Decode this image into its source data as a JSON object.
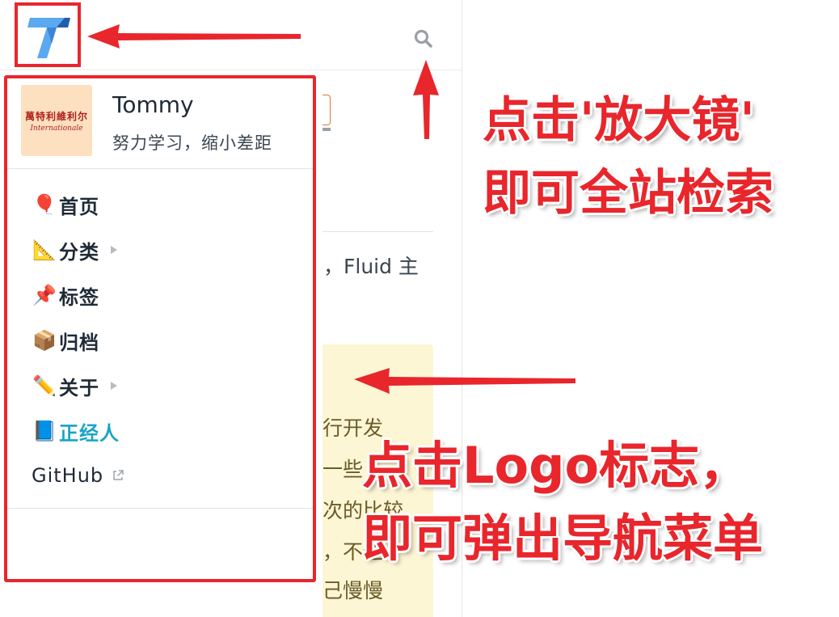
{
  "header": {
    "logo_icon": "fluid-t-logo-icon",
    "search_icon": "search-icon"
  },
  "profile": {
    "avatar_text_cn": "萬特利維利尔",
    "avatar_text_en": "Internationale",
    "name": "Tommy",
    "motto": "努力学习，缩小差距"
  },
  "nav": {
    "items": [
      {
        "emoji": "🎈",
        "icon": "balloon-icon",
        "label": "首页",
        "has_submenu": false
      },
      {
        "emoji": "📐",
        "icon": "triangle-ruler-icon",
        "label": "分类",
        "has_submenu": true
      },
      {
        "emoji": "📌",
        "icon": "pushpin-icon",
        "label": "标签",
        "has_submenu": false
      },
      {
        "emoji": "📦",
        "icon": "package-icon",
        "label": "归档",
        "has_submenu": false
      },
      {
        "emoji": "✏️",
        "icon": "pencil-icon",
        "label": "关于",
        "has_submenu": true
      },
      {
        "emoji": "📘",
        "icon": "blue-book-icon",
        "label": "正经人",
        "has_submenu": false,
        "active": true
      }
    ],
    "github_label": "GitHub",
    "external_icon": "external-link-icon"
  },
  "background_page": {
    "fluid_text": "，Fluid 主",
    "note_lines": [
      "行开发",
      "一些",
      "次的比较",
      "，不过",
      "己慢慢"
    ]
  },
  "annotations": {
    "search_hint_line1": "点击'放大镜'",
    "search_hint_line2": "即可全站检索",
    "logo_hint_line1": "点击Logo标志，",
    "logo_hint_line2": "即可弹出导航菜单"
  },
  "colors": {
    "annotation_red": "#e8262c",
    "active_nav": "#1aa4c6",
    "text_dark": "#1e2a36",
    "note_bg": "#fdf6d4"
  }
}
